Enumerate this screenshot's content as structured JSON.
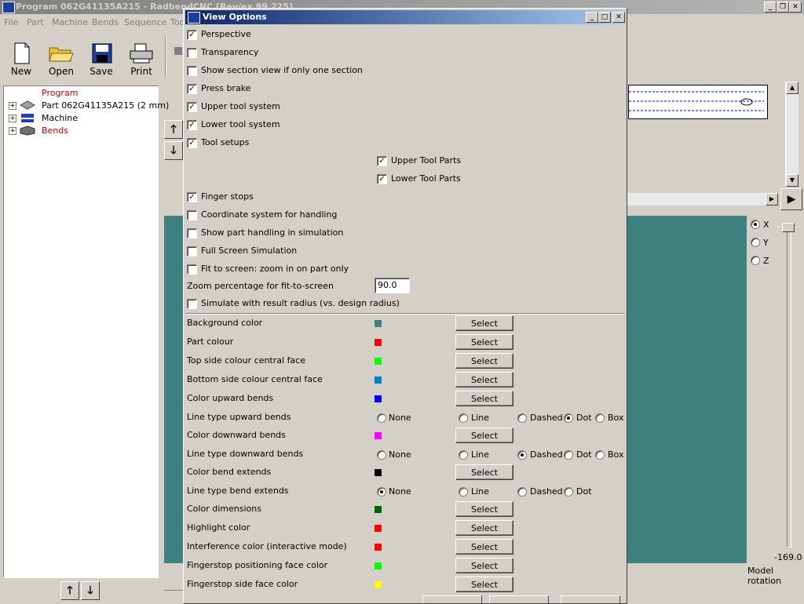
{
  "app": {
    "title": "Program 062G41135A215 - RadbendCNC [Rev/ex 99.225]",
    "menu": [
      "File",
      "Part",
      "Machine",
      "Bends",
      "Sequence",
      "Too"
    ],
    "toolbar": [
      {
        "label": "New",
        "icon": "new-document-icon"
      },
      {
        "label": "Open",
        "icon": "open-folder-icon"
      },
      {
        "label": "Save",
        "icon": "floppy-disk-icon"
      },
      {
        "label": "Print",
        "icon": "printer-icon"
      }
    ],
    "tree": {
      "root": "Program",
      "items": [
        {
          "label": "Part 062G41135A215 (2 mm)",
          "icon": "part-icon"
        },
        {
          "label": "Machine",
          "icon": "machine-icon"
        },
        {
          "label": "Bends",
          "icon": "bends-icon"
        }
      ]
    },
    "axis_options": [
      "X",
      "Y",
      "Z"
    ],
    "rotation_value": "-169.0",
    "rotation_label": "Model rotation"
  },
  "dialog": {
    "title": "View Options",
    "checkboxes": [
      {
        "label": "Perspective",
        "checked": true
      },
      {
        "label": "Transparency",
        "checked": false
      },
      {
        "label": "Show section view if only one section",
        "checked": false
      },
      {
        "label": "Press brake",
        "checked": true
      },
      {
        "label": "Upper tool system",
        "checked": true
      },
      {
        "label": "Lower tool system",
        "checked": true
      },
      {
        "label": "Tool setups",
        "checked": true
      }
    ],
    "sub_checkboxes": [
      {
        "label": "Upper Tool Parts",
        "checked": true
      },
      {
        "label": "Lower Tool Parts",
        "checked": true
      }
    ],
    "checkboxes2": [
      {
        "label": "Finger stops",
        "checked": true
      },
      {
        "label": "Coordinate system for handling",
        "checked": false
      },
      {
        "label": "Show part handling in simulation",
        "checked": false
      },
      {
        "label": "Full Screen Simulation",
        "checked": false
      },
      {
        "label": "Fit to screen: zoom in on part only",
        "checked": false
      }
    ],
    "zoom_label": "Zoom percentage for fit-to-screen",
    "zoom_value": "90.0",
    "simulate_label": "Simulate with result radius (vs. design radius)",
    "select_label": "Select",
    "radio_labels": [
      "None",
      "Line",
      "Dashed",
      "Dot",
      "Box"
    ],
    "colors": [
      {
        "label": "Background color",
        "color": "#3f8080"
      },
      {
        "label": "Part colour",
        "color": "#ff0000"
      },
      {
        "label": "Top side colour central face",
        "color": "#00ff00"
      },
      {
        "label": "Bottom side colour central face",
        "color": "#0080c0"
      },
      {
        "label": "Color upward bends",
        "color": "#0000ff"
      }
    ],
    "line_upward": {
      "label": "Line type upward bends",
      "selected": "Dot"
    },
    "color_downward": {
      "label": "Color downward bends",
      "color": "#ff00ff"
    },
    "line_downward": {
      "label": "Line type downward bends",
      "selected": "Dashed"
    },
    "color_extends": {
      "label": "Color bend extends",
      "color": "#000000"
    },
    "line_extends": {
      "label": "Line type bend extends",
      "selected": "None"
    },
    "colors2": [
      {
        "label": "Color dimensions",
        "color": "#006400"
      },
      {
        "label": "Highlight color",
        "color": "#ff0000"
      },
      {
        "label": "Interference color (interactive mode)",
        "color": "#ff0000"
      },
      {
        "label": "Fingerstop positioning face color",
        "color": "#00ff00"
      },
      {
        "label": "Fingerstop side face color",
        "color": "#ffff00"
      }
    ]
  }
}
